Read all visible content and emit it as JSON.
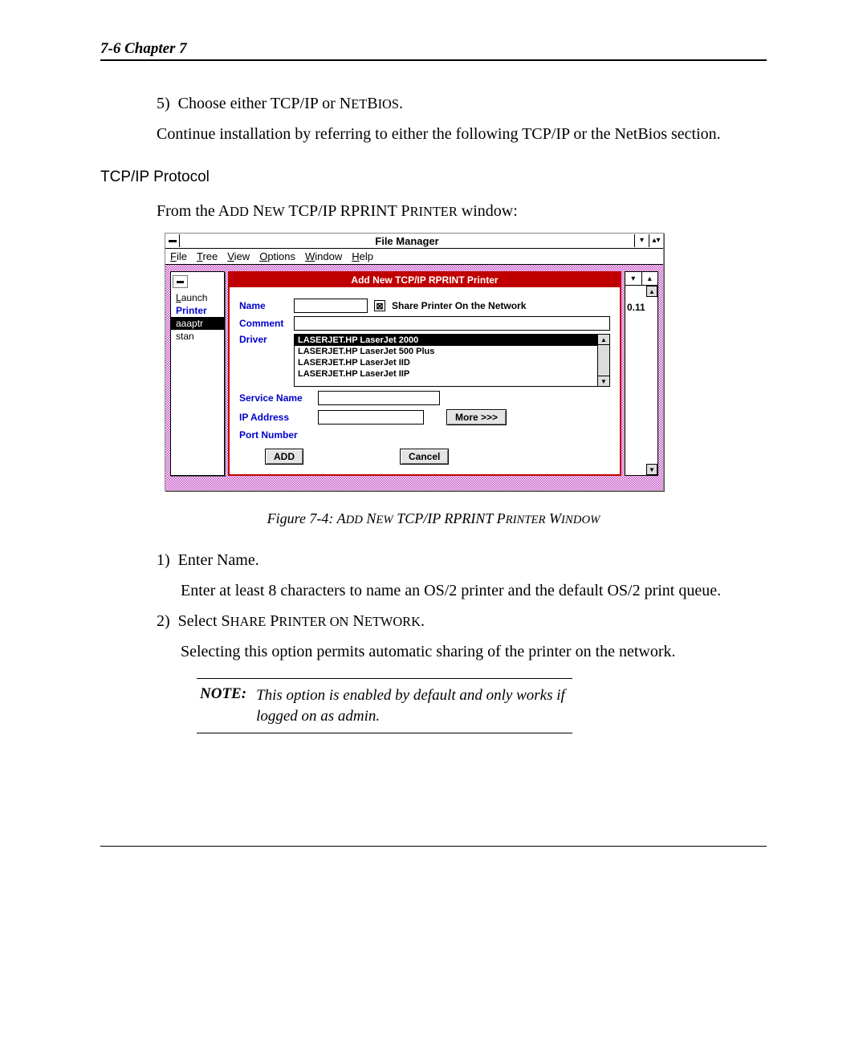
{
  "header": "7-6   Chapter 7",
  "step5_num": "5)",
  "step5_text": "Choose either TCP/IP or NETBIOS.",
  "cont": "Continue installation by referring to either the following TCP/IP or the NetBios section.",
  "section": "TCP/IP Protocol",
  "from_line_a": "From the A",
  "from_line_b": "DD",
  "from_line_c": " N",
  "from_line_d": "EW",
  "from_line_e": " TCP/IP RPRINT P",
  "from_line_f": "RINTER",
  "from_line_g": " window:",
  "win_title": "File Manager",
  "menu": {
    "file": "File",
    "tree": "Tree",
    "view": "View",
    "options": "Options",
    "window": "Window",
    "help": "Help"
  },
  "sidebar": {
    "launch": "Launch",
    "printer": "Printer",
    "aaaptr": "aaaptr",
    "stan": "stan"
  },
  "right_val": "0.11",
  "dialog": {
    "title": "Add New TCP/IP RPRINT Printer",
    "name_lbl": "Name",
    "share_lbl": "Share Printer On the Network",
    "comment_lbl": "Comment",
    "driver_lbl": "Driver",
    "drivers": [
      "LASERJET.HP LaserJet 2000",
      "LASERJET.HP LaserJet 500 Plus",
      "LASERJET.HP LaserJet IID",
      "LASERJET.HP LaserJet IIP"
    ],
    "svc_lbl": "Service Name",
    "ip_lbl": "IP Address",
    "port_lbl": "Port Number",
    "more_btn": "More >>>",
    "add_btn": "ADD",
    "cancel_btn": "Cancel"
  },
  "figcap_a": "Figure 7-4: A",
  "figcap_b": "DD",
  "figcap_c": " N",
  "figcap_d": "EW",
  "figcap_e": " TCP/IP RPRINT P",
  "figcap_f": "RINTER",
  "figcap_g": " W",
  "figcap_h": "INDOW",
  "s1_num": "1)",
  "s1_head": "Enter Name.",
  "s1_body": "Enter at least 8 characters to name an OS/2 printer and the default OS/2 print queue.",
  "s2_num": "2)",
  "s2_a": "Select S",
  "s2_b": "HARE",
  "s2_c": " P",
  "s2_d": "RINTER ON",
  "s2_e": " N",
  "s2_f": "ETWORK",
  "s2_g": ".",
  "s2_body": "Selecting this option permits automatic sharing of the printer on the network.",
  "note_label": "NOTE:",
  "note_text": "This option is enabled by default and only works if logged on as admin."
}
